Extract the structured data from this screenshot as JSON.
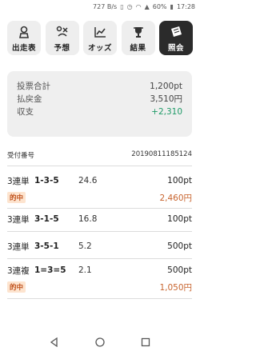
{
  "status": {
    "speed": "727 B/s",
    "battery": "60%",
    "time": "17:28"
  },
  "nav": [
    {
      "label": "出走表",
      "icon": "jockey-icon"
    },
    {
      "label": "予想",
      "icon": "forecast-icon"
    },
    {
      "label": "オッズ",
      "icon": "chart-icon"
    },
    {
      "label": "結果",
      "icon": "trophy-icon"
    },
    {
      "label": "照会",
      "icon": "ticket-icon",
      "active": true
    }
  ],
  "summary": {
    "total_label": "投票合計",
    "total_value": "1,200pt",
    "payout_label": "払戻金",
    "payout_value": "3,510円",
    "balance_label": "収支",
    "balance_value": "+2,310"
  },
  "receipt": {
    "label": "受付番号",
    "number": "20190811185124"
  },
  "bets": [
    {
      "type": "3連単",
      "combo": "1-3-5",
      "odds": "24.6",
      "stake": "100pt",
      "hit": "的中",
      "payout": "2,460円"
    },
    {
      "type": "3連単",
      "combo": "3-1-5",
      "odds": "16.8",
      "stake": "100pt"
    },
    {
      "type": "3連単",
      "combo": "3-5-1",
      "odds": "5.2",
      "stake": "500pt"
    },
    {
      "type": "3連複",
      "combo": "1=3=5",
      "odds": "2.1",
      "stake": "500pt",
      "hit": "的中",
      "payout": "1,050円"
    }
  ],
  "colors": {
    "accent_positive": "#1f9a67",
    "payout": "#c8642e",
    "hit_bg": "#fde4cf"
  }
}
